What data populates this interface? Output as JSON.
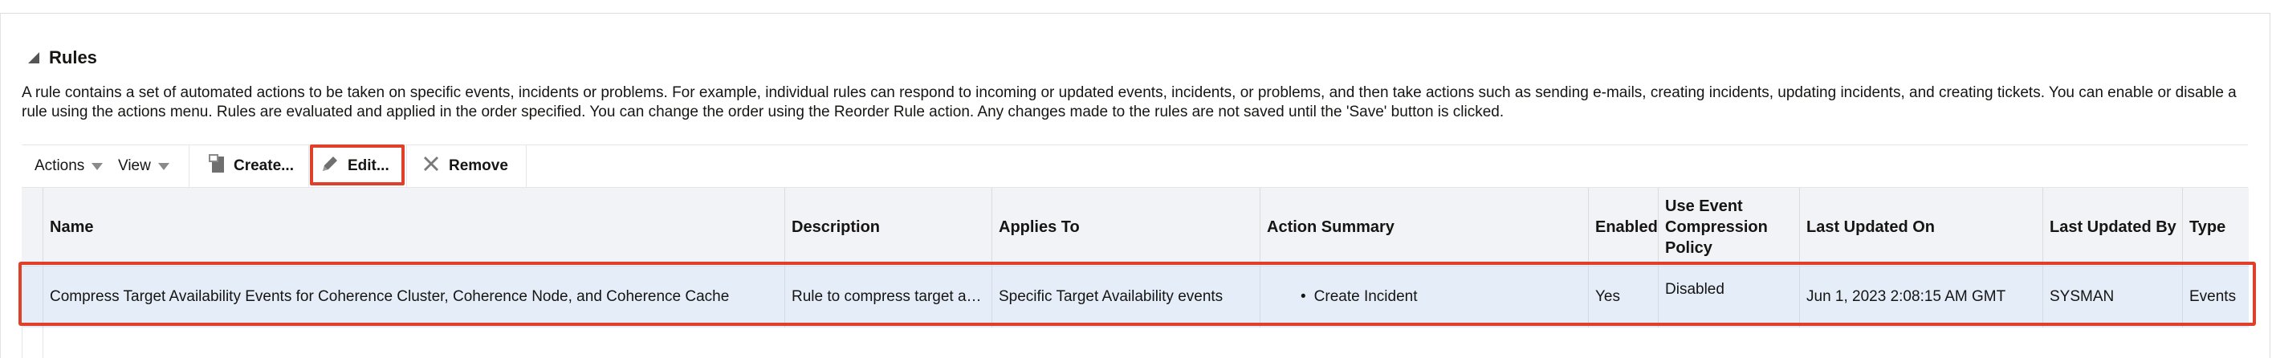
{
  "section": {
    "title": "Rules"
  },
  "description": "A rule contains a set of automated actions to be taken on specific events, incidents or problems. For example, individual rules can respond to incoming or updated events, incidents, or problems, and then take actions such as sending e-mails, creating incidents, updating incidents, and creating tickets. You can enable or disable a rule using the actions menu. Rules are evaluated and applied in the order specified. You can change the order using the Reorder Rule action. Any changes made to the rules are not saved until the 'Save' button is clicked.",
  "toolbar": {
    "actions_label": "Actions",
    "view_label": "View",
    "create_label": "Create...",
    "edit_label": "Edit...",
    "remove_label": "Remove"
  },
  "table": {
    "headers": {
      "name": "Name",
      "description": "Description",
      "applies_to": "Applies To",
      "action_summary": "Action Summary",
      "enabled": "Enabled",
      "compression": "Use Event Compression Policy",
      "last_updated_on": "Last Updated On",
      "last_updated_by": "Last Updated By",
      "type": "Type"
    },
    "rows": [
      {
        "name": "Compress Target Availability Events for Coherence Cluster, Coherence Node, and Coherence Cache",
        "description": "Rule to compress target a…",
        "applies_to": "Specific Target Availability events",
        "action_summary": "Create Incident",
        "enabled": "Yes",
        "compression": "Disabled",
        "last_updated_on": "Jun 1, 2023 2:08:15 AM GMT",
        "last_updated_by": "SYSMAN",
        "type": "Events"
      }
    ]
  },
  "colors": {
    "highlight": "#e0402a",
    "selected_row": "#e4edf8",
    "header_bg": "#f1f3f7"
  }
}
